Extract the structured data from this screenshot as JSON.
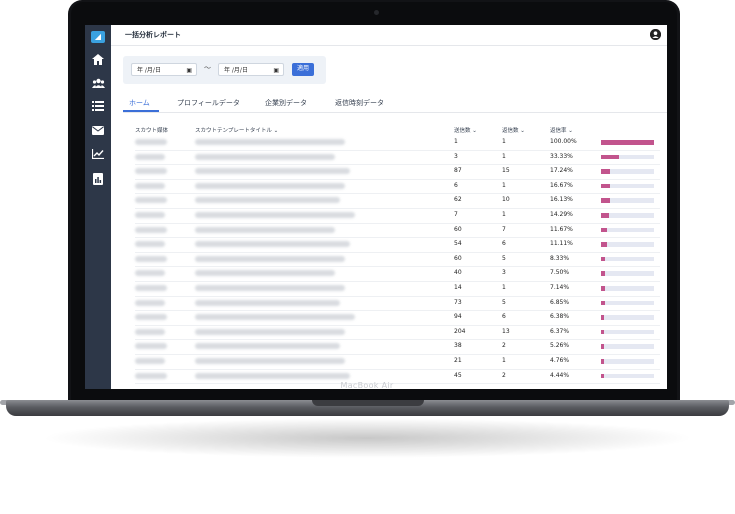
{
  "device": {
    "brand_label": "MacBook Air"
  },
  "app": {
    "title": "一括分析レポート"
  },
  "filter": {
    "start_date_placeholder": "年 /月/日",
    "end_date_placeholder": "年 /月/日",
    "separator": "〜",
    "apply_label": "適用"
  },
  "tabs": [
    {
      "label": "ホーム",
      "active": true
    },
    {
      "label": "プロフィールデータ",
      "active": false
    },
    {
      "label": "企業別データ",
      "active": false
    },
    {
      "label": "返信時刻データ",
      "active": false
    }
  ],
  "table": {
    "headers": {
      "media": "スカウト媒体",
      "template": "スカウトテンプレートタイトル ⌄",
      "sent": "送信数 ⌄",
      "replies": "返信数 ⌄",
      "rate": "返信率 ⌄"
    },
    "rows": [
      {
        "sent": "1",
        "replies": "1",
        "rate": "100.00%",
        "rate_value": 100.0
      },
      {
        "sent": "3",
        "replies": "1",
        "rate": "33.33%",
        "rate_value": 33.33
      },
      {
        "sent": "87",
        "replies": "15",
        "rate": "17.24%",
        "rate_value": 17.24
      },
      {
        "sent": "6",
        "replies": "1",
        "rate": "16.67%",
        "rate_value": 16.67
      },
      {
        "sent": "62",
        "replies": "10",
        "rate": "16.13%",
        "rate_value": 16.13
      },
      {
        "sent": "7",
        "replies": "1",
        "rate": "14.29%",
        "rate_value": 14.29
      },
      {
        "sent": "60",
        "replies": "7",
        "rate": "11.67%",
        "rate_value": 11.67
      },
      {
        "sent": "54",
        "replies": "6",
        "rate": "11.11%",
        "rate_value": 11.11
      },
      {
        "sent": "60",
        "replies": "5",
        "rate": "8.33%",
        "rate_value": 8.33
      },
      {
        "sent": "40",
        "replies": "3",
        "rate": "7.50%",
        "rate_value": 7.5
      },
      {
        "sent": "14",
        "replies": "1",
        "rate": "7.14%",
        "rate_value": 7.14
      },
      {
        "sent": "73",
        "replies": "5",
        "rate": "6.85%",
        "rate_value": 6.85
      },
      {
        "sent": "94",
        "replies": "6",
        "rate": "6.38%",
        "rate_value": 6.38
      },
      {
        "sent": "204",
        "replies": "13",
        "rate": "6.37%",
        "rate_value": 6.37
      },
      {
        "sent": "38",
        "replies": "2",
        "rate": "5.26%",
        "rate_value": 5.26
      },
      {
        "sent": "21",
        "replies": "1",
        "rate": "4.76%",
        "rate_value": 4.76
      },
      {
        "sent": "45",
        "replies": "2",
        "rate": "4.44%",
        "rate_value": 4.44
      }
    ]
  },
  "sidebar": {
    "items": [
      {
        "icon": "home-icon",
        "glyph": "⌂"
      },
      {
        "icon": "users-icon",
        "glyph": "👥"
      },
      {
        "icon": "list-icon",
        "glyph": "☰"
      },
      {
        "icon": "mail-icon",
        "glyph": "✉"
      },
      {
        "icon": "line-chart-icon",
        "glyph": "📈"
      },
      {
        "icon": "report-icon",
        "glyph": "▤"
      }
    ]
  },
  "colors": {
    "sidebar": "#2d3748",
    "accent": "#3b6fd8",
    "bar": "#c2548d",
    "bar_track": "#e5e8f2"
  }
}
